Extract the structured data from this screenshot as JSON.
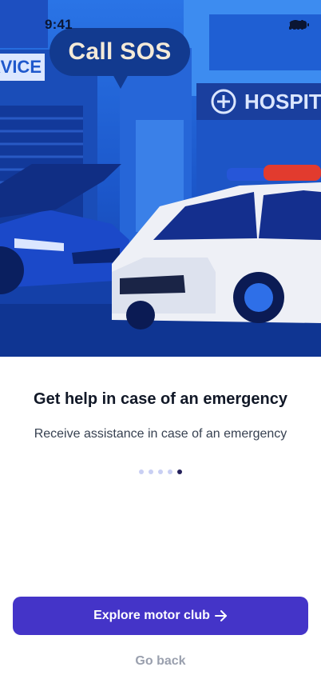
{
  "status_bar": {
    "time": "9:41",
    "icons": [
      "cellular-signal-icon",
      "wifi-icon",
      "battery-icon"
    ]
  },
  "hero": {
    "bubble_text": "Call SOS",
    "signs": {
      "service": "RVICE",
      "hospital": "HOSPIT"
    },
    "colors": {
      "sky": "#2a74e6",
      "building": "#1b56c9",
      "dark_blue": "#123a8f",
      "ambulance_body": "#eef0f6",
      "siren_red": "#e23b2e"
    }
  },
  "onboarding": {
    "title": "Get help in case of an emergency",
    "subtitle": "Receive assistance in case of an emergency",
    "pagination": {
      "total": 5,
      "active": 5
    }
  },
  "actions": {
    "primary_label": "Explore motor club",
    "primary_icon": "arrow-right-icon",
    "secondary_label": "Go back"
  },
  "colors": {
    "primary": "#4434c8",
    "title_text": "#111827",
    "muted_text": "#9aa0ae"
  }
}
